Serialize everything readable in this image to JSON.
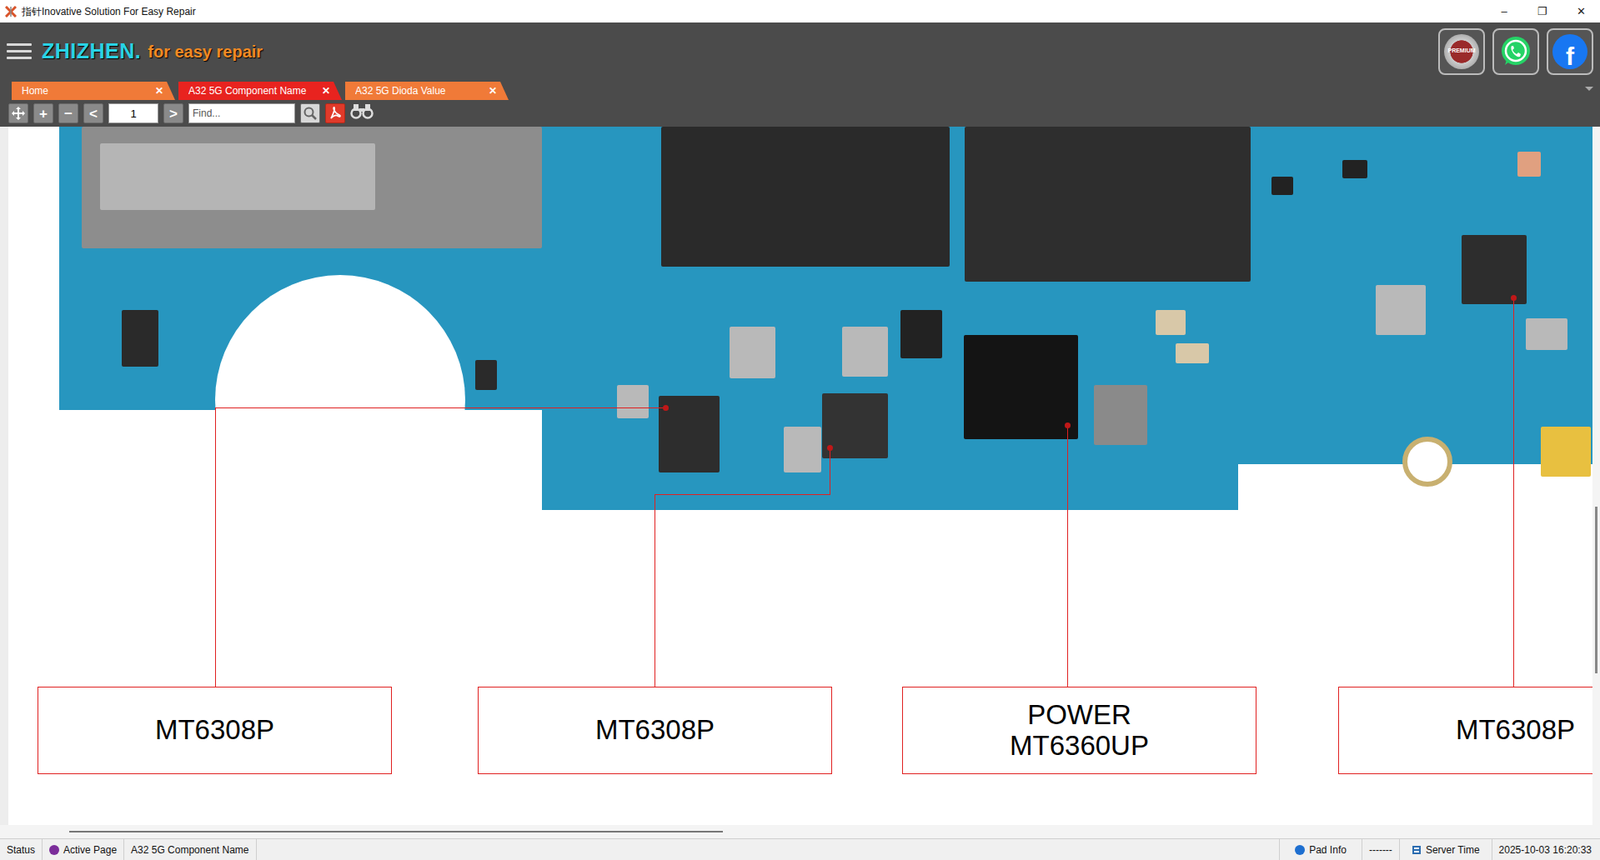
{
  "window": {
    "title": "指针Inovative Solution For Easy Repair",
    "controls": [
      "–",
      "❐",
      "✕"
    ]
  },
  "header": {
    "brand": "ZHIZHEN.",
    "tagline": "for easy repair",
    "premium": "PREMIUM",
    "facebook": "f"
  },
  "tabs": [
    {
      "label": "Home",
      "selected": false,
      "close": "✕"
    },
    {
      "label": "A32 5G Component Name",
      "selected": true,
      "close": "✕"
    },
    {
      "label": "A32 5G Dioda Value",
      "selected": false,
      "close": "✕"
    }
  ],
  "toolbar": {
    "zoom_in": "+",
    "zoom_out": "−",
    "prev": "<",
    "page": "1",
    "next": ">",
    "search_placeholder": "Find..."
  },
  "callouts": [
    {
      "lines": [
        "MT6308P"
      ]
    },
    {
      "lines": [
        "MT6308P"
      ]
    },
    {
      "lines": [
        "POWER",
        "MT6360UP"
      ]
    },
    {
      "lines": [
        "MT6308P"
      ]
    }
  ],
  "status_bar": {
    "status": "Status",
    "active_page_label": "Active Page",
    "active_page": "A32 5G Component Name",
    "pad_info": "Pad Info",
    "pad_value": "-------",
    "server_time_label": "Server Time",
    "server_time": "2025-10-03 16:20:33"
  }
}
